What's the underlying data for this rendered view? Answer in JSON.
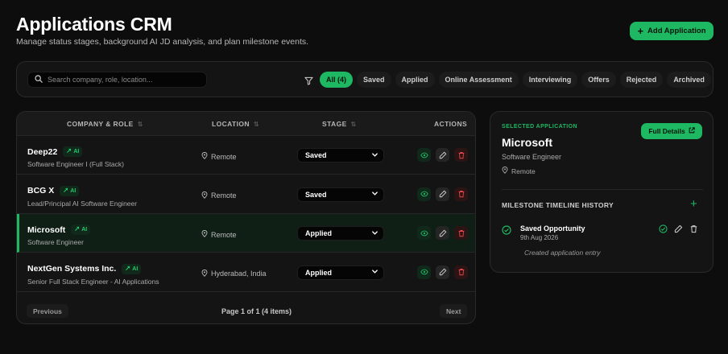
{
  "header": {
    "title": "Applications CRM",
    "subtitle": "Manage status stages, background AI JD analysis, and plan milestone events.",
    "add_label": "Add Application"
  },
  "filters": {
    "search_placeholder": "Search company, role, location...",
    "chips": [
      {
        "label": "All (4)",
        "active": true
      },
      {
        "label": "Saved",
        "active": false
      },
      {
        "label": "Applied",
        "active": false
      },
      {
        "label": "Online Assessment",
        "active": false
      },
      {
        "label": "Interviewing",
        "active": false
      },
      {
        "label": "Offers",
        "active": false
      },
      {
        "label": "Rejected",
        "active": false
      },
      {
        "label": "Archived",
        "active": false
      }
    ]
  },
  "table": {
    "columns": {
      "company": "COMPANY & ROLE",
      "location": "LOCATION",
      "stage": "STAGE",
      "actions": "ACTIONS"
    },
    "ai_badge": "AI",
    "rows": [
      {
        "company": "Deep22",
        "role": "Software Engineer I (Full Stack)",
        "location": "Remote",
        "stage": "Saved",
        "selected": false
      },
      {
        "company": "BCG X",
        "role": "Lead/Principal AI Software Engineer",
        "location": "Remote",
        "stage": "Saved",
        "selected": false
      },
      {
        "company": "Microsoft",
        "role": "Software Engineer",
        "location": "Remote",
        "stage": "Applied",
        "selected": true
      },
      {
        "company": "NextGen Systems Inc.",
        "role": "Senior Full Stack Engineer - AI Applications",
        "location": "Hyderabad, India",
        "stage": "Applied",
        "selected": false
      }
    ],
    "pagination": {
      "previous": "Previous",
      "info": "Page 1 of 1 (4 items)",
      "next": "Next"
    }
  },
  "detail": {
    "label": "SELECTED APPLICATION",
    "full_details": "Full Details",
    "company": "Microsoft",
    "role": "Software Engineer",
    "location": "Remote",
    "milestone_title": "MILESTONE TIMELINE HISTORY",
    "milestones": [
      {
        "name": "Saved Opportunity",
        "date": "9th Aug 2026",
        "note": "Created application entry"
      }
    ]
  },
  "colors": {
    "accent": "#1fb862",
    "background": "#0d0d0d",
    "card": "#141414",
    "danger": "#e0464a"
  }
}
